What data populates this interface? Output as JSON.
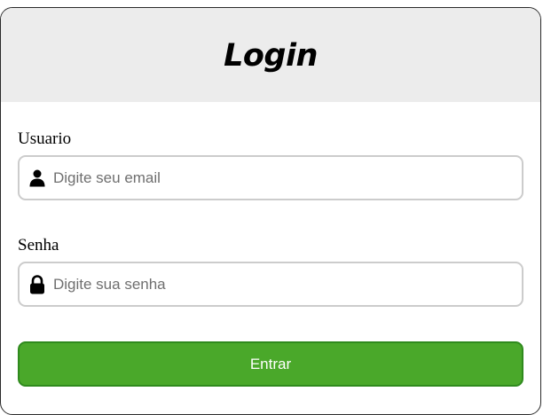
{
  "header": {
    "title": "Login"
  },
  "form": {
    "user": {
      "label": "Usuario",
      "placeholder": "Digite seu email",
      "icon": "user-icon"
    },
    "password": {
      "label": "Senha",
      "placeholder": "Digite sua senha",
      "icon": "lock-icon"
    },
    "submit_label": "Entrar"
  },
  "colors": {
    "header_bg": "#ececec",
    "button_bg": "#4aa82a",
    "button_border": "#2f8a1d",
    "field_border": "#cccccc"
  }
}
